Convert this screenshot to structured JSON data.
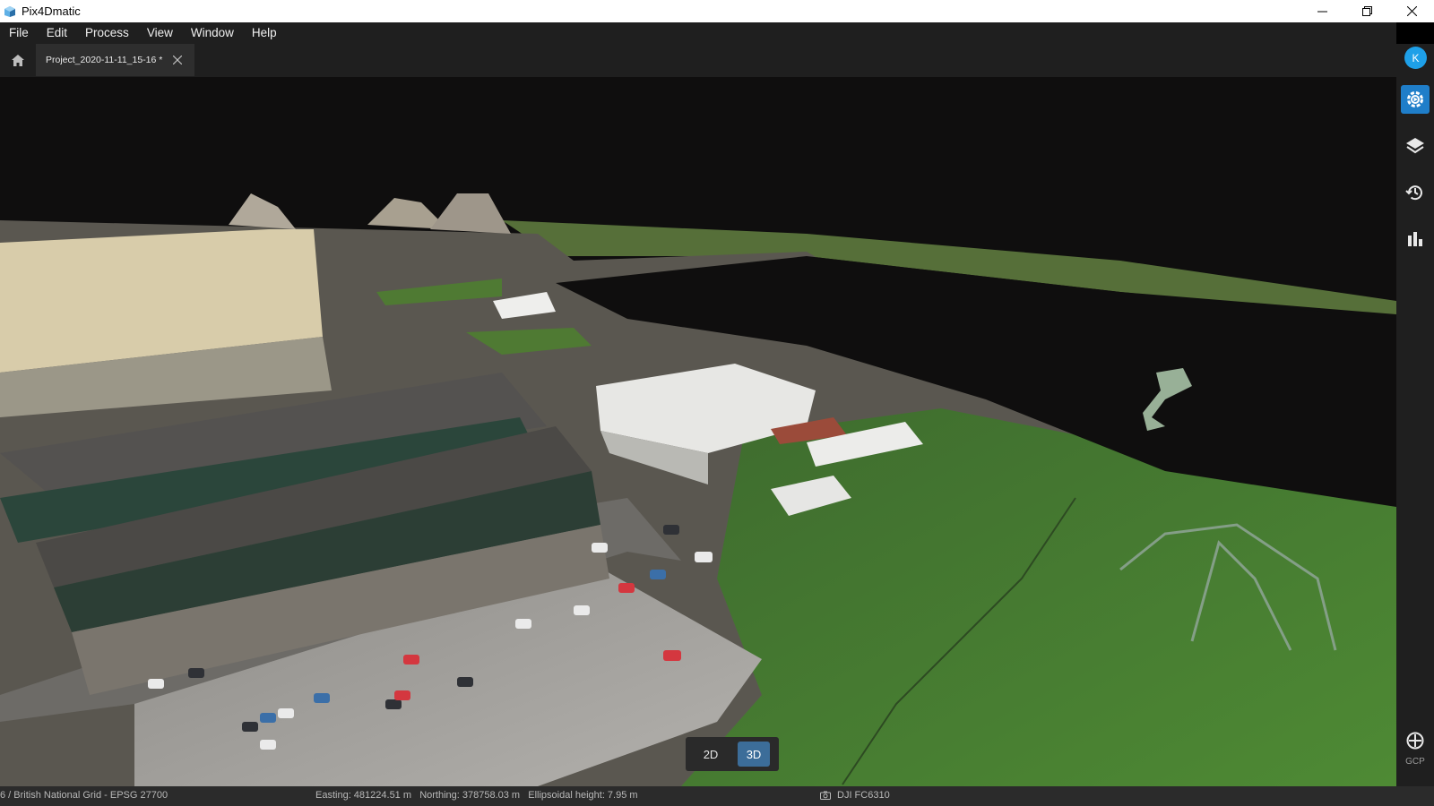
{
  "window": {
    "title": "Pix4Dmatic",
    "minimize_icon": "minimize-icon",
    "restore_icon": "restore-icon",
    "close_icon": "close-icon"
  },
  "menu": {
    "items": [
      "File",
      "Edit",
      "Process",
      "View",
      "Window",
      "Help"
    ]
  },
  "tabs": {
    "home_icon": "home-icon",
    "active_tab": "Project_2020-11-11_15-16 *",
    "close_icon": "close-icon"
  },
  "sidebar": {
    "avatar_initial": "K",
    "buttons": [
      "processing-gear-icon",
      "layers-icon",
      "history-icon",
      "statistics-icon"
    ],
    "gcp_label": "GCP"
  },
  "viewport": {
    "view_modes": [
      "2D",
      "3D"
    ],
    "active_mode": "3D"
  },
  "statusbar": {
    "crs": "6 / British National Grid - EPSG 27700",
    "coordinates": "Easting: 481224.51 m   Northing: 378758.03 m   Ellipsoidal height: 7.95 m",
    "camera": "DJI FC6310"
  },
  "colors": {
    "accent": "#1f7ec9",
    "avatar": "#1ea0e8",
    "toggle_active": "#3c6d99",
    "chrome": "#1f1f1f"
  }
}
